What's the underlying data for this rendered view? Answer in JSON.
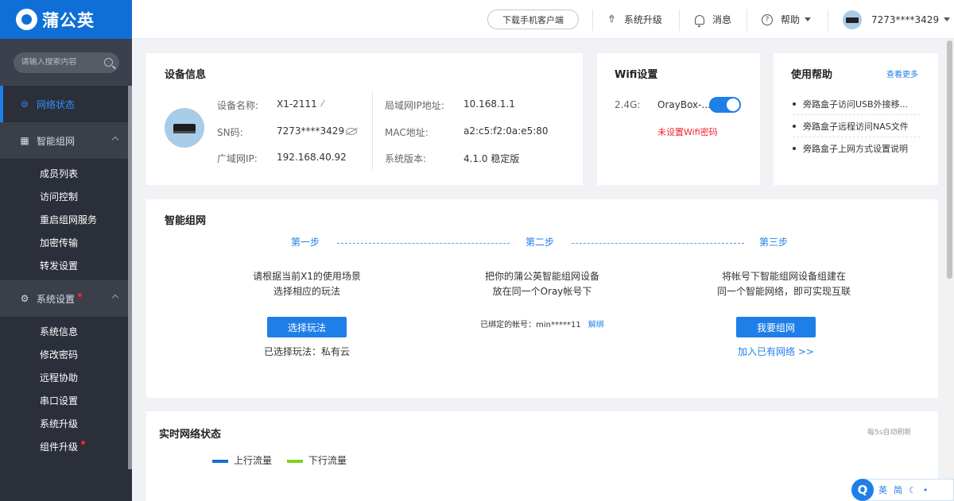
{
  "brand": {
    "name": "蒲公英"
  },
  "search": {
    "placeholder": "请输入搜索内容"
  },
  "nav": {
    "network_status": "网络状态",
    "smart_network": "智能组网",
    "smart_network_items": [
      "成员列表",
      "访问控制",
      "重启组网服务",
      "加密传输",
      "转发设置"
    ],
    "system_settings": "系统设置",
    "system_settings_items": [
      "系统信息",
      "修改密码",
      "远程协助",
      "串口设置",
      "系统升级",
      "组件升级"
    ]
  },
  "header": {
    "download_app": "下载手机客户端",
    "system_upgrade": "系统升级",
    "messages": "消息",
    "help": "帮助",
    "account": "7273****3429"
  },
  "device": {
    "title": "设备信息",
    "name_label": "设备名称:",
    "name_value": "X1-2111",
    "sn_label": "SN码:",
    "sn_value": "7273****3429",
    "wan_label": "广域网IP:",
    "wan_value": "192.168.40.92",
    "lan_label": "局域网IP地址:",
    "lan_value": "10.168.1.1",
    "mac_label": "MAC地址:",
    "mac_value": "a2:c5:f2:0a:e5:80",
    "version_label": "系统版本:",
    "version_value": "4.1.0 稳定版"
  },
  "wifi": {
    "title": "Wifi设置",
    "band": "2.4G:",
    "ssid": "OrayBox-...",
    "enabled": true,
    "warning": "未设置Wifi密码"
  },
  "help": {
    "title": "使用帮助",
    "more": "查看更多",
    "items": [
      "旁路盒子访问USB外接移...",
      "旁路盒子远程访问NAS文件",
      "旁路盒子上网方式设置说明"
    ]
  },
  "smart": {
    "title": "智能组网",
    "step1": "第一步",
    "step2": "第二步",
    "step3": "第三步",
    "step1_line1": "请根据当前X1的使用场景",
    "step1_line2": "选择相应的玩法",
    "step1_button": "选择玩法",
    "step1_selected": "已选择玩法：私有云",
    "step2_line1": "把你的蒲公英智能组网设备",
    "step2_line2": "放在同一个Oray帐号下",
    "step2_bound_label": "已绑定的帐号：min*****11",
    "step2_unbind": "解绑",
    "step3_line1": "将帐号下智能组网设备组建在",
    "step3_line2": "同一个智能网络，即可实现互联",
    "step3_button": "我要组网",
    "step3_link": "加入已有网络 >>"
  },
  "realtime": {
    "title": "实时网络状态",
    "refresh_note": "每5s自动刷新",
    "legend_up": "上行流量",
    "legend_down": "下行流量",
    "colors": {
      "up": "#1a6fd1",
      "down": "#7ed321"
    }
  },
  "widget": {
    "logo": "Q",
    "lang": "英",
    "simp": "简",
    "moon": "☾",
    "dot": "•"
  },
  "colors": {
    "brand": "#0f6fd6",
    "accent": "#1f7fe8",
    "sidebar": "#2b2f39",
    "warning": "#f5222d"
  }
}
